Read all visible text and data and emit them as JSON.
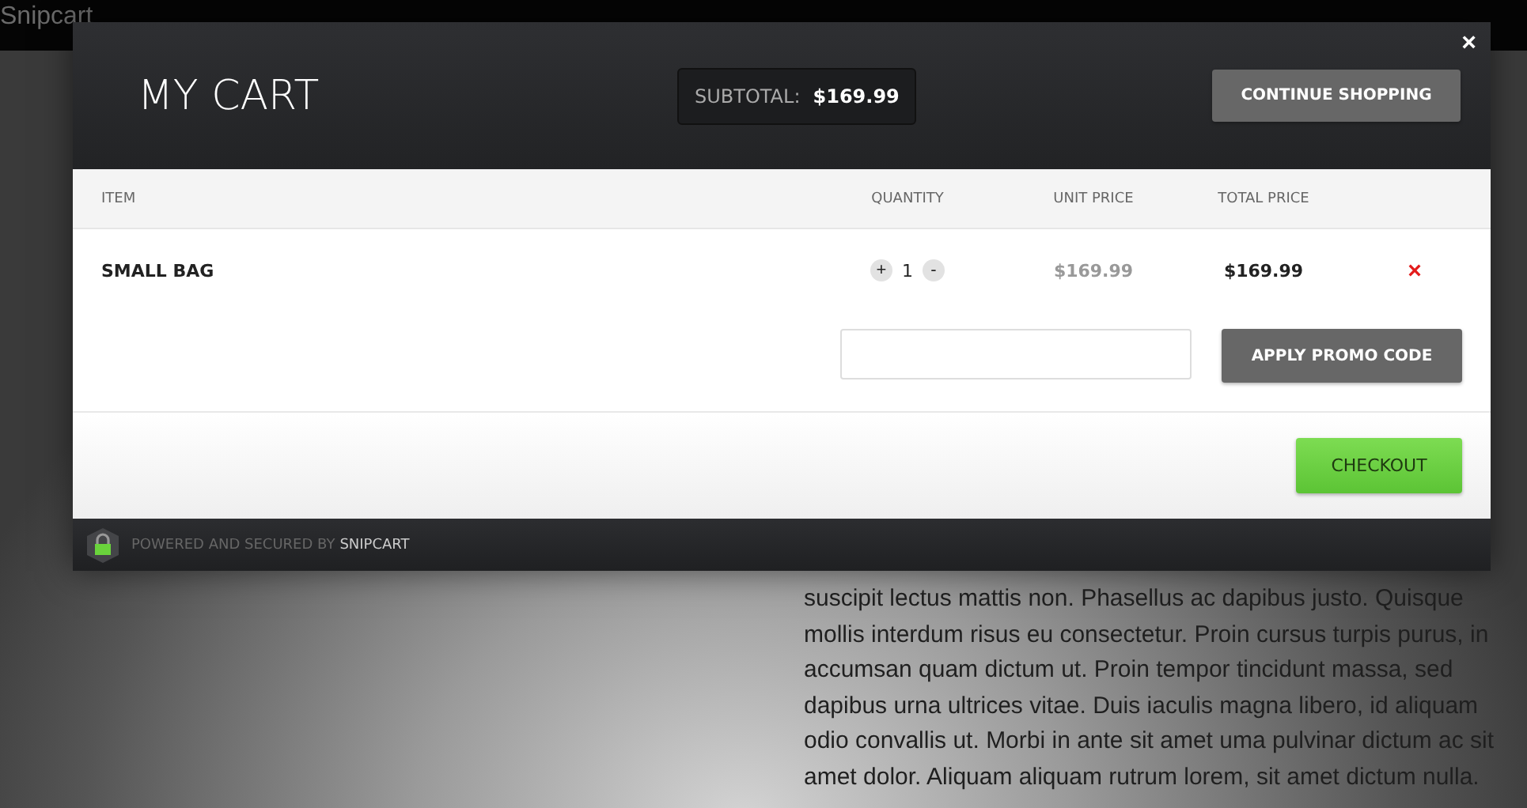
{
  "page": {
    "brand": "Snipcart",
    "paragraph_lines": [
      "suscipit lectus mattis non. Phasellus ac dapibus justo. Quisque",
      "mollis interdum risus eu consectetur. Proin cursus turpis purus, in",
      "accumsan quam dictum ut. Proin tempor tincidunt massa, sed",
      "dapibus urna ultrices vitae. Duis iaculis magna libero, id aliquam",
      "odio convallis ut. Morbi in ante sit amet uma pulvinar dictum ac sit",
      "amet dolor. Aliquam aliquam rutrum lorem, sit amet dictum nulla."
    ]
  },
  "cart": {
    "title": "MY CART",
    "subtotal_label": "SUBTOTAL:",
    "subtotal": "$169.99",
    "continue_button": "CONTINUE SHOPPING",
    "close": "×",
    "columns": [
      "ITEM",
      "QUANTITY",
      "UNIT PRICE",
      "TOTAL PRICE"
    ],
    "items": [
      {
        "name": "SMALL BAG",
        "increase": "+",
        "quantity": "1",
        "decrease": "-",
        "unit_price": "$169.99",
        "total_price": "$169.99",
        "remove": "×"
      }
    ],
    "promo_button": "APPLY PROMO CODE",
    "checkout_button": "CHECKOUT",
    "footer": {
      "text": "POWERED AND SECURED BY",
      "brand": "SNIPCART"
    }
  }
}
